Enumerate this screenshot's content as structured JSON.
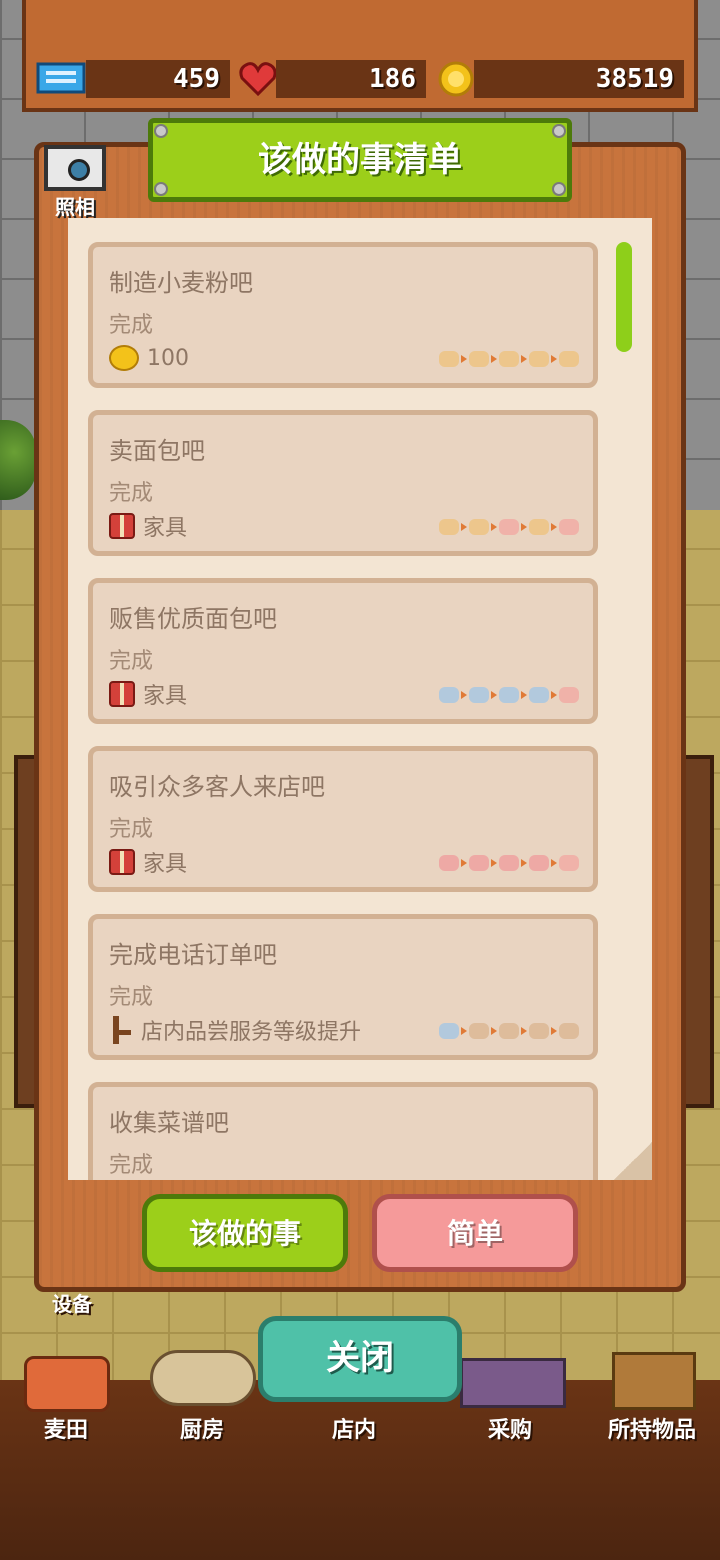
{
  "stats": {
    "tickets": "459",
    "hearts": "186",
    "coins": "38519"
  },
  "modal": {
    "title": "该做的事清单",
    "camera_label": "照相",
    "tasks": [
      {
        "title": "制造小麦粉吧",
        "status": "完成",
        "reward_icon": "coins-icon",
        "reward_text": "100",
        "progress_icons": [
          "bread",
          "bread",
          "bread",
          "bread",
          "bread"
        ]
      },
      {
        "title": "卖面包吧",
        "status": "完成",
        "reward_icon": "gift-icon",
        "reward_text": "家具",
        "progress_icons": [
          "bread",
          "bread",
          "gift",
          "bread",
          "gift"
        ]
      },
      {
        "title": "贩售优质面包吧",
        "status": "完成",
        "reward_icon": "gift-icon",
        "reward_text": "家具",
        "progress_icons": [
          "ticket",
          "ticket",
          "ticket",
          "ticket",
          "gift"
        ]
      },
      {
        "title": "吸引众多客人来店吧",
        "status": "完成",
        "reward_icon": "gift-icon",
        "reward_text": "家具",
        "progress_icons": [
          "heart",
          "heart",
          "heart",
          "heart",
          "gift"
        ]
      },
      {
        "title": "完成电话订单吧",
        "status": "完成",
        "reward_icon": "chair-icon",
        "reward_text": "店内品尝服务等级提升",
        "progress_icons": [
          "ticket",
          "chair",
          "chair",
          "chair",
          "chair"
        ]
      },
      {
        "title": "收集菜谱吧",
        "status": "完成"
      }
    ],
    "tab_todo": "该做的事",
    "tab_simple": "简单",
    "close": "关闭"
  },
  "background": {
    "equip_label": "设备"
  },
  "bottom_nav": [
    "麦田",
    "厨房",
    "店内",
    "采购",
    "所持物品"
  ],
  "colors": {
    "green": "#9ccf1a",
    "pink": "#f59a9a",
    "teal": "#4fc1a8",
    "wood": "#c8743d"
  }
}
